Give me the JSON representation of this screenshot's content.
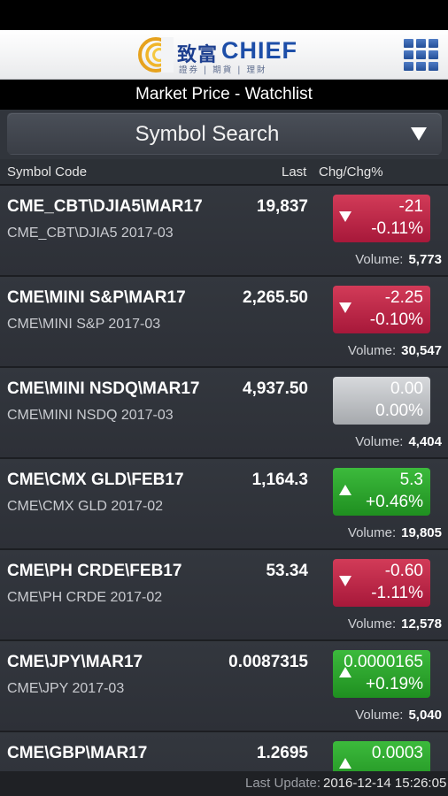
{
  "header": {
    "logo_cn": "致富",
    "logo_en": "CHIEF",
    "logo_sub": "證券 | 期貨 | 理財",
    "menu_icon": "grid-menu-icon"
  },
  "title": "Market Price - Watchlist",
  "search": {
    "label": "Symbol Search"
  },
  "columns": {
    "symbol": "Symbol Code",
    "last": "Last",
    "change": "Chg/Chg%"
  },
  "volume_label": "Volume:",
  "colors": {
    "down": "#b8213f",
    "up": "#2aa52a",
    "flat": "#bfc1c4"
  },
  "rows": [
    {
      "symbol": "CME_CBT\\DJIA5\\MAR17",
      "desc": "CME_CBT\\DJIA5 2017-03",
      "last": "19,837",
      "chg": "-21",
      "pct": "-0.11%",
      "dir": "down",
      "volume": "5,773"
    },
    {
      "symbol": "CME\\MINI S&P\\MAR17",
      "desc": "CME\\MINI S&P 2017-03",
      "last": "2,265.50",
      "chg": "-2.25",
      "pct": "-0.10%",
      "dir": "down",
      "volume": "30,547"
    },
    {
      "symbol": "CME\\MINI NSDQ\\MAR17",
      "desc": "CME\\MINI NSDQ 2017-03",
      "last": "4,937.50",
      "chg": "0.00",
      "pct": "0.00%",
      "dir": "flat",
      "volume": "4,404"
    },
    {
      "symbol": "CME\\CMX GLD\\FEB17",
      "desc": "CME\\CMX GLD 2017-02",
      "last": "1,164.3",
      "chg": "5.3",
      "pct": "+0.46%",
      "dir": "up",
      "volume": "19,805"
    },
    {
      "symbol": "CME\\PH CRDE\\FEB17",
      "desc": "CME\\PH CRDE 2017-02",
      "last": "53.34",
      "chg": "-0.60",
      "pct": "-1.11%",
      "dir": "down",
      "volume": "12,578"
    },
    {
      "symbol": "CME\\JPY\\MAR17",
      "desc": "CME\\JPY 2017-03",
      "last": "0.0087315",
      "chg": "0.0000165",
      "pct": "+0.19%",
      "dir": "up",
      "volume": "5,040"
    },
    {
      "symbol": "CME\\GBP\\MAR17",
      "desc": "",
      "last": "1.2695",
      "chg": "0.0003",
      "pct": "",
      "dir": "up",
      "volume": ""
    }
  ],
  "footer": {
    "label": "Last Update:",
    "value": "2016-12-14 15:26:05"
  }
}
